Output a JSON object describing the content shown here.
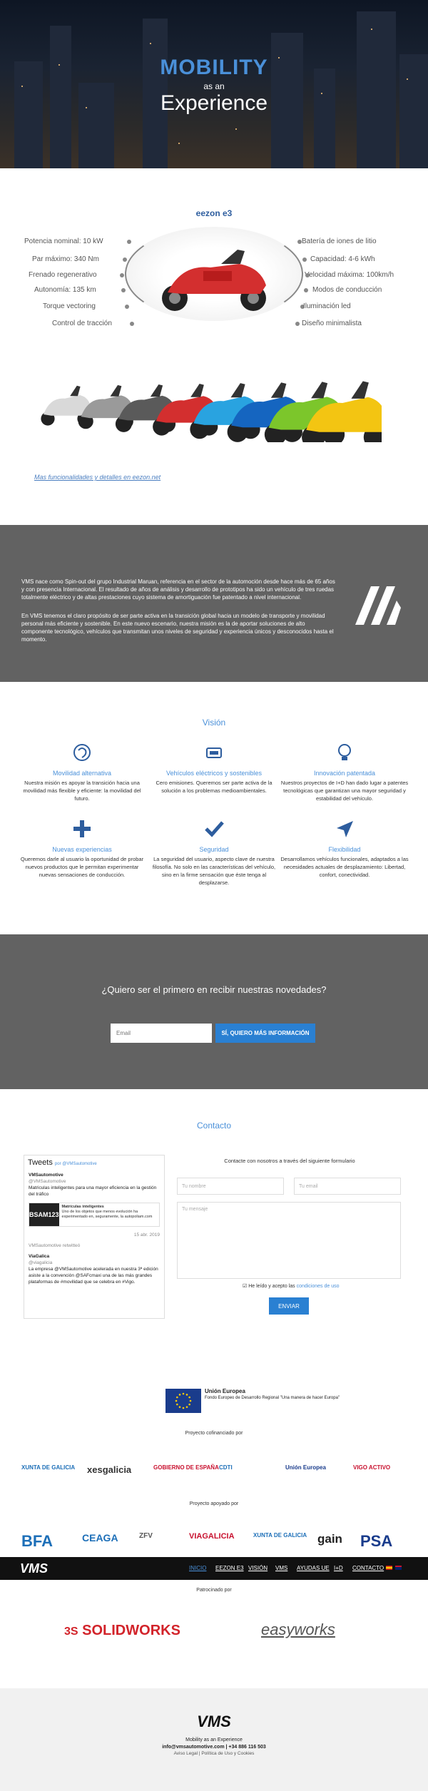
{
  "hero": {
    "title": "MOBILITY",
    "as": "as an",
    "subtitle": "Experience"
  },
  "product": {
    "title": "eezon e3",
    "features_left": [
      "Potencia nominal: 10 kW",
      "Par máximo: 340 Nm",
      "Frenado regenerativo",
      "Autonomía: 135 km",
      "Torque vectoring",
      "Control de tracción"
    ],
    "features_right": [
      "Batería de iones de litio",
      "Capacidad: 4-6 kWh",
      "Velocidad máxima: 100km/h",
      "Modos de conducción",
      "Iluminación led",
      "Diseño minimalista"
    ],
    "more_link": "Mas funcionalidades y detalles en eezon.net",
    "lineup_colors": [
      "#d9d9d9",
      "#9a9a9a",
      "#5a5a5a",
      "#d32f2f",
      "#29a3e0",
      "#1565c0",
      "#7cc62b",
      "#f3c512"
    ],
    "hero_color": "#d32f2f"
  },
  "about": {
    "p1": "VMS nace como Spin-out del grupo Industrial Maruan, referencia en el sector de la automoción desde hace más de 65 años y con presencia Internacional. El resultado de años de análisis y desarrollo de prototipos ha sido un vehículo de tres ruedas totalmente eléctrico y de altas prestaciones cuyo sistema de amortiguación fue patentado a nivel internacional.",
    "p2": "En VMS tenemos el claro propósito de ser parte activa en la transición global hacia un modelo de transporte y movilidad personal más eficiente y sostenible. En este nuevo escenario, nuestra misión es la de aportar soluciones de alto componente tecnológico, vehículos que transmitan unos niveles de seguridad y experiencia únicos y desconocidos hasta el momento."
  },
  "vision": {
    "title": "Visión",
    "items": [
      {
        "icon": "brain-icon",
        "title": "Movilidad alternativa",
        "text": "Nuestra misión es apoyar la transición hacia una movilidad más flexible y eficiente: la movilidad del futuro."
      },
      {
        "icon": "battery-icon",
        "title": "Vehículos eléctricos y sostenibles",
        "text": "Cero emisiones. Queremos ser parte activa de la solución a los problemas medioambientales."
      },
      {
        "icon": "lightbulb-icon",
        "title": "Innovación patentada",
        "text": "Nuestros proyectos de I+D han dado lugar a patentes tecnológicas que garantizan una mayor seguridad y estabilidad del vehículo."
      },
      {
        "icon": "plus-icon",
        "title": "Nuevas experiencias",
        "text": "Queremos darle al usuario la oportunidad de probar nuevos productos que le permitan experimentar nuevas sensaciones de conducción."
      },
      {
        "icon": "check-icon",
        "title": "Seguridad",
        "text": "La seguridad del usuario, aspecto clave de nuestra filosofía. No solo en las características del vehículo, sino en la firme sensación que éste tenga al desplazarse."
      },
      {
        "icon": "navigation-icon",
        "title": "Flexibilidad",
        "text": "Desarrollamos vehículos funcionales, adaptados a las necesidades actuales de desplazamiento: Libertad, confort, conectividad."
      }
    ]
  },
  "newsletter": {
    "question": "¿Quiero ser el primero en recibir nuestras novedades?",
    "email_placeholder": "Email",
    "button": "SÍ, QUIERO MÁS INFORMACIÓN"
  },
  "contact": {
    "title": "Contacto",
    "form_label": "Contacte con nosotros a través del siguiente formulario",
    "name_placeholder": "Tu nombre",
    "email_placeholder": "Tu email",
    "message_placeholder": "Tu mensaje",
    "terms_prefix": "He leído y acepto las",
    "terms_link": "condiciones de uso",
    "send": "ENVIAR"
  },
  "twitter": {
    "header": "Tweets",
    "by": "por @VMSautomotive",
    "account1": "VMSautomotive",
    "handle1": "@VMSautomotive",
    "tweet1": "Matriculas inteligentes para una mayor eficiencia en la gestión del tráfico",
    "card_img": "BSAM123",
    "card_title": "Matrículas inteligentes",
    "card_text": "Uno de los objetos que menos evolución ha experimentado en, seguramente, la autopoliam.com",
    "date1": "15 abr. 2019",
    "retweet": "VMSautomotive retwitteó",
    "account2": "ViaGalica",
    "handle2": "@viagalicia",
    "tweet2": "La empresa @VMSautomotive acelerada en nuestra 3ª edición asiste a la convención @SAFcmaxi una de las más grandes plataformas de #movilidad que se celebra en #Vigo."
  },
  "funding": {
    "eu_title": "Unión Europea",
    "eu_text": "Fondo Europeo de Desarrollo Regional \"Una manera de hacer Europa\"",
    "cofinanced": "Proyecto cofinanciado por",
    "cofin_logos": [
      "XUNTA DE GALICIA",
      "xesgalicia",
      "GOBIERNO DE ESPAÑA",
      "CDTI",
      "Unión Europea",
      "VIGO ACTIVO"
    ],
    "supported": "Proyecto apoyado por",
    "support_logos": [
      "BFA",
      "CEAGA",
      "ZFV",
      "VIAGALICIA",
      "XUNTA DE GALICIA",
      "gain",
      "PSA"
    ],
    "sponsored": "Patrocinado por",
    "sponsor_logos": [
      "SOLIDWORKS",
      "easyworks"
    ]
  },
  "nav": {
    "logo": "VMS",
    "items": [
      "INICIO",
      "EEZON E3",
      "VISIÓN",
      "VMS",
      "AYUDAS UE",
      "I+D",
      "CONTACTO"
    ]
  },
  "footer": {
    "logo": "VMS",
    "tagline": "Mobility as an Experience",
    "contact": "info@vmsautomotive.com | +34 886 116 503",
    "links": "Aviso Legal | Política de Uso y Cookies"
  },
  "colors": {
    "accent": "#4a90d9",
    "dark_band": "#626262",
    "button": "#2a80d2"
  }
}
